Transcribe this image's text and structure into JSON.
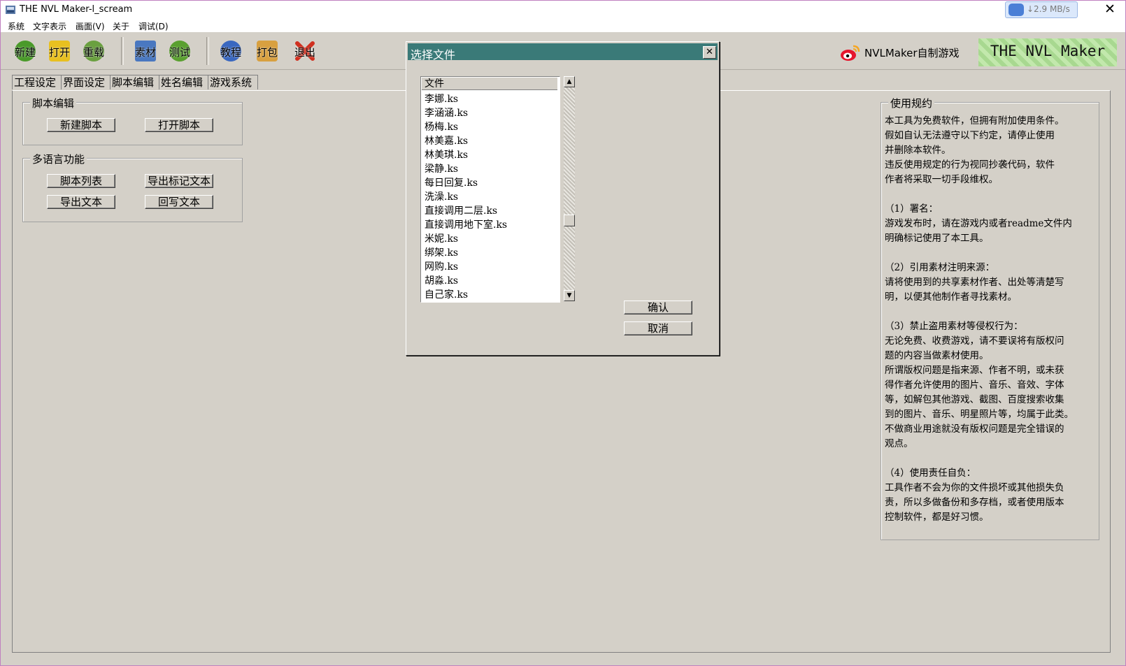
{
  "window": {
    "title": "THE NVL Maker-l_scream",
    "close_glyph": "✕",
    "net_speed": "↓2.9 MB/s"
  },
  "menu": [
    "系统",
    "文字表示",
    "画面(V)",
    "关于",
    "调试(D)"
  ],
  "toolbar": {
    "buttons": [
      {
        "label": "新建",
        "icon": "new-icon",
        "color": "#4a9a2a"
      },
      {
        "label": "打开",
        "icon": "folder-icon",
        "color": "#e8c020"
      },
      {
        "label": "重载",
        "icon": "reload-icon",
        "color": "#6aa040"
      },
      {
        "label": "素材",
        "icon": "material-icon",
        "color": "#4a78c0"
      },
      {
        "label": "测试",
        "icon": "test-icon",
        "color": "#5aa030"
      },
      {
        "label": "教程",
        "icon": "info-icon",
        "color": "#3a68c0"
      },
      {
        "label": "打包",
        "icon": "package-icon",
        "color": "#d8a040"
      },
      {
        "label": "退出",
        "icon": "exit-icon",
        "color": "#d03020"
      }
    ],
    "weibo_text": "NVLMaker自制游戏",
    "brand_text": "THE NVL Maker"
  },
  "tabs": [
    "工程设定",
    "界面设定",
    "脚本编辑",
    "姓名编辑",
    "游戏系统"
  ],
  "script_group": {
    "title": "脚本编辑",
    "new_script": "新建脚本",
    "open_script": "打开脚本"
  },
  "lang_group": {
    "title": "多语言功能",
    "script_list": "脚本列表",
    "export_marked": "导出标记文本",
    "export_text": "导出文本",
    "write_back": "回写文本"
  },
  "terms": {
    "title": "使用规约",
    "body": "本工具为免费软件，但拥有附加使用条件。\n假如自认无法遵守以下约定，请停止使用\n并删除本软件。\n违反使用规定的行为视同抄袭代码，软件\n作者将采取一切手段维权。\n\n（1）署名：\n游戏发布时，请在游戏内或者readme文件内\n明确标记使用了本工具。\n\n（2）引用素材注明来源：\n请将使用到的共享素材作者、出处等清楚写\n明，以便其他制作者寻找素材。\n\n（3）禁止盗用素材等侵权行为：\n无论免费、收费游戏，请不要误将有版权问\n题的内容当做素材使用。\n所谓版权问题是指来源、作者不明，或未获\n得作者允许使用的图片、音乐、音效、字体\n等，如解包其他游戏、截图、百度搜索收集\n到的图片、音乐、明星照片等，均属于此类。\n不做商业用途就没有版权问题是完全错误的\n观点。\n\n（4）使用责任自负：\n工具作者不会为你的文件损坏或其他损失负\n责，所以多做备份和多存档，或者使用版本\n控制软件，都是好习惯。"
  },
  "dialog": {
    "title": "选择文件",
    "close_glyph": "✕",
    "list_header": "文件",
    "files": [
      "李娜.ks",
      "李涵涵.ks",
      "杨梅.ks",
      "林美嘉.ks",
      "林美琪.ks",
      "梁静.ks",
      "每日回复.ks",
      "洗澡.ks",
      "直接调用二层.ks",
      "直接调用地下室.ks",
      "米妮.ks",
      "绑架.ks",
      "网购.ks",
      "胡淼.ks",
      "自己家.ks"
    ],
    "confirm": "确认",
    "cancel": "取消",
    "scroll_up": "▲",
    "scroll_down": "▼"
  }
}
